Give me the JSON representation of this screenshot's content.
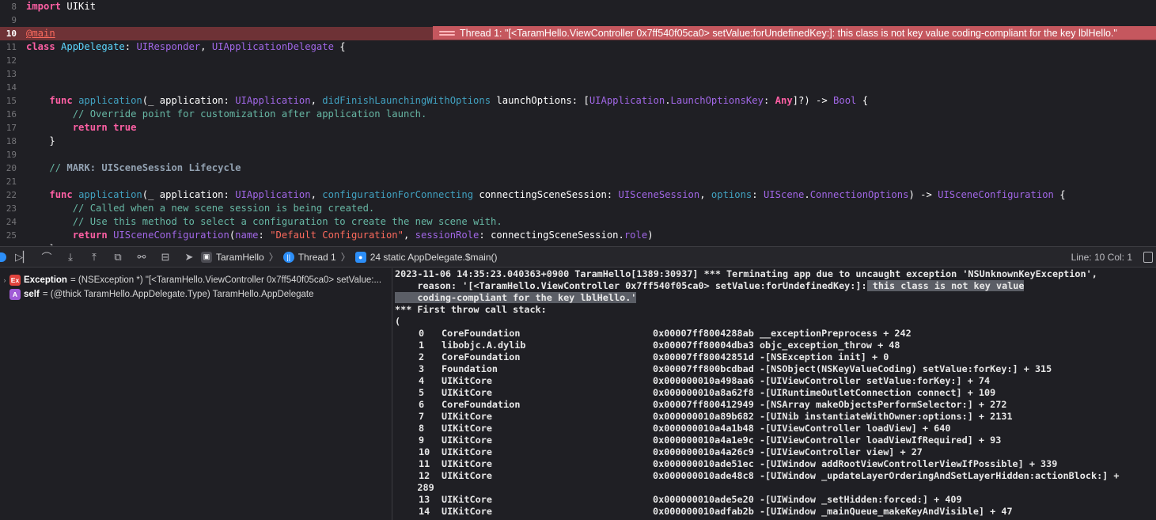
{
  "editor": {
    "lines": [
      {
        "num": "8",
        "tokens": [
          {
            "c": "kw",
            "t": "import"
          },
          {
            "c": "plain",
            "t": " UIKit"
          }
        ]
      },
      {
        "num": "9",
        "tokens": []
      },
      {
        "num": "10",
        "error": true,
        "tokens": [
          {
            "c": "at",
            "t": "@main"
          }
        ]
      },
      {
        "num": "11",
        "tokens": [
          {
            "c": "kw",
            "t": "class"
          },
          {
            "c": "plain",
            "t": " "
          },
          {
            "c": "ty",
            "t": "AppDelegate"
          },
          {
            "c": "plain",
            "t": ": "
          },
          {
            "c": "prop",
            "t": "UIResponder"
          },
          {
            "c": "plain",
            "t": ", "
          },
          {
            "c": "prop",
            "t": "UIApplicationDelegate"
          },
          {
            "c": "plain",
            "t": " {"
          }
        ]
      },
      {
        "num": "12",
        "tokens": []
      },
      {
        "num": "13",
        "tokens": []
      },
      {
        "num": "14",
        "tokens": []
      },
      {
        "num": "15",
        "tokens": [
          {
            "c": "plain",
            "t": "    "
          },
          {
            "c": "kw",
            "t": "func"
          },
          {
            "c": "plain",
            "t": " "
          },
          {
            "c": "param",
            "t": "application"
          },
          {
            "c": "plain",
            "t": "(_ application: "
          },
          {
            "c": "prop",
            "t": "UIApplication"
          },
          {
            "c": "plain",
            "t": ", "
          },
          {
            "c": "param",
            "t": "didFinishLaunchingWithOptions"
          },
          {
            "c": "plain",
            "t": " launchOptions: ["
          },
          {
            "c": "prop",
            "t": "UIApplication"
          },
          {
            "c": "plain",
            "t": "."
          },
          {
            "c": "prop",
            "t": "LaunchOptionsKey"
          },
          {
            "c": "plain",
            "t": ": "
          },
          {
            "c": "kw",
            "t": "Any"
          },
          {
            "c": "plain",
            "t": "]?) -> "
          },
          {
            "c": "prop",
            "t": "Bool"
          },
          {
            "c": "plain",
            "t": " {"
          }
        ]
      },
      {
        "num": "16",
        "tokens": [
          {
            "c": "plain",
            "t": "        "
          },
          {
            "c": "fn",
            "t": "// Override point for customization after application launch."
          }
        ]
      },
      {
        "num": "17",
        "tokens": [
          {
            "c": "plain",
            "t": "        "
          },
          {
            "c": "kw",
            "t": "return"
          },
          {
            "c": "plain",
            "t": " "
          },
          {
            "c": "kw",
            "t": "true"
          }
        ]
      },
      {
        "num": "18",
        "tokens": [
          {
            "c": "plain",
            "t": "    }"
          }
        ]
      },
      {
        "num": "19",
        "tokens": []
      },
      {
        "num": "20",
        "tokens": [
          {
            "c": "plain",
            "t": "    "
          },
          {
            "c": "fn",
            "t": "// "
          },
          {
            "c": "mk",
            "t": "MARK: UISceneSession Lifecycle"
          }
        ]
      },
      {
        "num": "21",
        "tokens": []
      },
      {
        "num": "22",
        "tokens": [
          {
            "c": "plain",
            "t": "    "
          },
          {
            "c": "kw",
            "t": "func"
          },
          {
            "c": "plain",
            "t": " "
          },
          {
            "c": "param",
            "t": "application"
          },
          {
            "c": "plain",
            "t": "(_ application: "
          },
          {
            "c": "prop",
            "t": "UIApplication"
          },
          {
            "c": "plain",
            "t": ", "
          },
          {
            "c": "param",
            "t": "configurationForConnecting"
          },
          {
            "c": "plain",
            "t": " connectingSceneSession: "
          },
          {
            "c": "prop",
            "t": "UISceneSession"
          },
          {
            "c": "plain",
            "t": ", "
          },
          {
            "c": "param",
            "t": "options"
          },
          {
            "c": "plain",
            "t": ": "
          },
          {
            "c": "prop",
            "t": "UIScene"
          },
          {
            "c": "plain",
            "t": "."
          },
          {
            "c": "prop",
            "t": "ConnectionOptions"
          },
          {
            "c": "plain",
            "t": ") -> "
          },
          {
            "c": "prop",
            "t": "UISceneConfiguration"
          },
          {
            "c": "plain",
            "t": " {"
          }
        ]
      },
      {
        "num": "23",
        "tokens": [
          {
            "c": "plain",
            "t": "        "
          },
          {
            "c": "fn",
            "t": "// Called when a new scene session is being created."
          }
        ]
      },
      {
        "num": "24",
        "tokens": [
          {
            "c": "plain",
            "t": "        "
          },
          {
            "c": "fn",
            "t": "// Use this method to select a configuration to create the new scene with."
          }
        ]
      },
      {
        "num": "25",
        "tokens": [
          {
            "c": "plain",
            "t": "        "
          },
          {
            "c": "kw",
            "t": "return"
          },
          {
            "c": "plain",
            "t": " "
          },
          {
            "c": "prop",
            "t": "UISceneConfiguration"
          },
          {
            "c": "plain",
            "t": "("
          },
          {
            "c": "prop",
            "t": "name"
          },
          {
            "c": "plain",
            "t": ": "
          },
          {
            "c": "str",
            "t": "\"Default Configuration\""
          },
          {
            "c": "plain",
            "t": ", "
          },
          {
            "c": "prop",
            "t": "sessionRole"
          },
          {
            "c": "plain",
            "t": ": connectingSceneSession."
          },
          {
            "c": "prop",
            "t": "role"
          },
          {
            "c": "plain",
            "t": ")"
          }
        ]
      },
      {
        "num": "26",
        "tokens": [
          {
            "c": "plain",
            "t": "    }"
          }
        ]
      }
    ],
    "error_annotation": "Thread 1: \"[<TaramHello.ViewController 0x7ff540f05ca0> setValue:forUndefinedKey:]: this class is not key value coding-compliant for the key lblHello.\""
  },
  "debugbar": {
    "crumb_project": "TaramHello",
    "crumb_thread": "Thread 1",
    "crumb_frame": "24 static AppDelegate.$main()",
    "line_col": "Line: 10  Col: 1"
  },
  "variables": [
    {
      "badge": "Ex",
      "badge_color": "#e0443e",
      "name": "Exception",
      "value": "= (NSException *) \"[<TaramHello.ViewController 0x7ff540f05ca0> setValue:...",
      "expandable": true
    },
    {
      "badge": "A",
      "badge_color": "#a05bd6",
      "name": "self",
      "value": "= (@thick TaramHello.AppDelegate.Type) TaramHello.AppDelegate",
      "expandable": false
    }
  ],
  "console": {
    "header_line1": "2023-11-06 14:35:23.040363+0900 TaramHello[1389:30937] *** Terminating app due to uncaught exception 'NSUnknownKeyException',",
    "header_line2a": "    reason: '[<TaramHello.ViewController 0x7ff540f05ca0> setValue:forUndefinedKey:]:",
    "header_line2b": " this class is not key value",
    "header_line3": "    coding-compliant for the key lblHello.'",
    "stack_title": "*** First throw call stack:",
    "open_paren": "(",
    "frames": [
      {
        "idx": "0",
        "lib": "CoreFoundation",
        "addr": "0x00007ff8004288ab __exceptionPreprocess + 242"
      },
      {
        "idx": "1",
        "lib": "libobjc.A.dylib",
        "addr": "0x00007ff80004dba3 objc_exception_throw + 48"
      },
      {
        "idx": "2",
        "lib": "CoreFoundation",
        "addr": "0x00007ff80042851d -[NSException init] + 0"
      },
      {
        "idx": "3",
        "lib": "Foundation",
        "addr": "0x00007ff800bcdbad -[NSObject(NSKeyValueCoding) setValue:forKey:] + 315"
      },
      {
        "idx": "4",
        "lib": "UIKitCore",
        "addr": "0x000000010a498aa6 -[UIViewController setValue:forKey:] + 74"
      },
      {
        "idx": "5",
        "lib": "UIKitCore",
        "addr": "0x000000010a8a62f8 -[UIRuntimeOutletConnection connect] + 109"
      },
      {
        "idx": "6",
        "lib": "CoreFoundation",
        "addr": "0x00007ff800412949 -[NSArray makeObjectsPerformSelector:] + 272"
      },
      {
        "idx": "7",
        "lib": "UIKitCore",
        "addr": "0x000000010a89b682 -[UINib instantiateWithOwner:options:] + 2131"
      },
      {
        "idx": "8",
        "lib": "UIKitCore",
        "addr": "0x000000010a4a1b48 -[UIViewController loadView] + 640"
      },
      {
        "idx": "9",
        "lib": "UIKitCore",
        "addr": "0x000000010a4a1e9c -[UIViewController loadViewIfRequired] + 93"
      },
      {
        "idx": "10",
        "lib": "UIKitCore",
        "addr": "0x000000010a4a26c9 -[UIViewController view] + 27"
      },
      {
        "idx": "11",
        "lib": "UIKitCore",
        "addr": "0x000000010ade51ec -[UIWindow addRootViewControllerViewIfPossible] + 339"
      },
      {
        "idx": "12",
        "lib": "UIKitCore",
        "addr": "0x000000010ade48c8 -[UIWindow _updateLayerOrderingAndSetLayerHidden:actionBlock:] +",
        "cont": "289"
      },
      {
        "idx": "13",
        "lib": "UIKitCore",
        "addr": "0x000000010ade5e20 -[UIWindow _setHidden:forced:] + 409"
      },
      {
        "idx": "14",
        "lib": "UIKitCore",
        "addr": "0x000000010adfab2b -[UIWindow _mainQueue_makeKeyAndVisible] + 47"
      }
    ]
  }
}
